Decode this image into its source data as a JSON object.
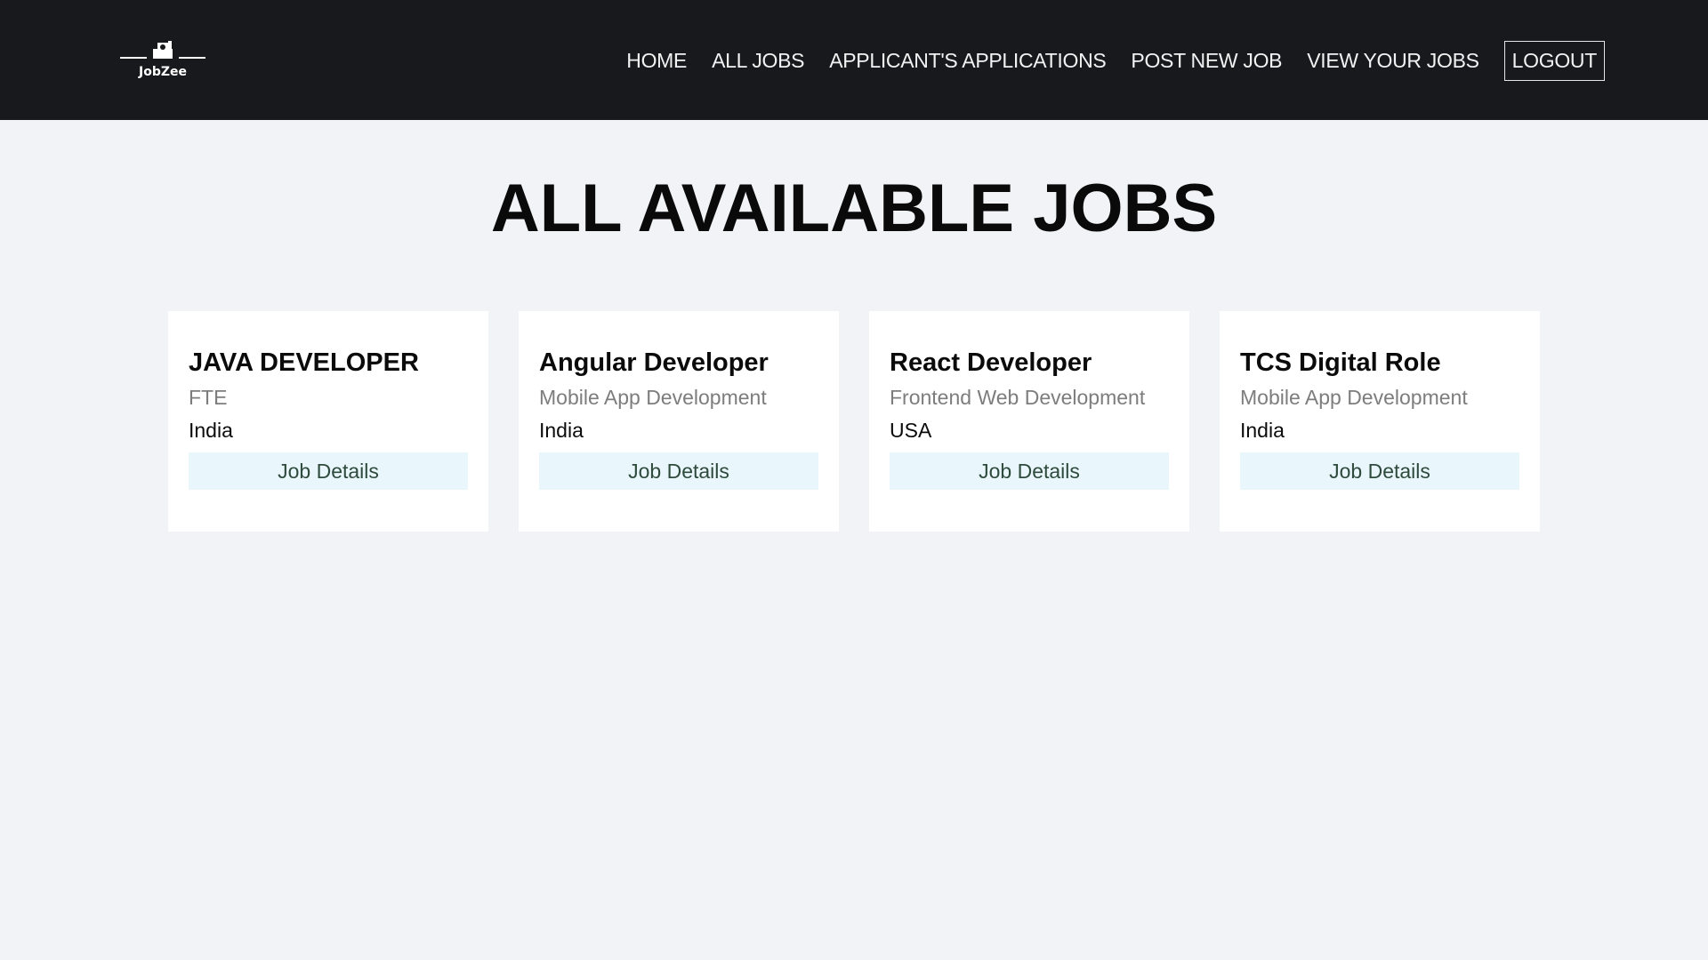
{
  "brand": {
    "logo_text": "JobZee",
    "logo_icon": "briefcase-hand-logo"
  },
  "nav": {
    "links": [
      {
        "label": "HOME"
      },
      {
        "label": "ALL JOBS"
      },
      {
        "label": "APPLICANT'S APPLICATIONS"
      },
      {
        "label": "POST NEW JOB"
      },
      {
        "label": "VIEW YOUR JOBS"
      }
    ],
    "logout_label": "LOGOUT"
  },
  "page": {
    "title": "ALL AVAILABLE JOBS"
  },
  "jobs": [
    {
      "title": "JAVA DEVELOPER",
      "category": "FTE",
      "country": "India",
      "button_label": "Job Details"
    },
    {
      "title": "Angular Developer",
      "category": "Mobile App Development",
      "country": "India",
      "button_label": "Job Details"
    },
    {
      "title": "React Developer",
      "category": "Frontend Web Development",
      "country": "USA",
      "button_label": "Job Details"
    },
    {
      "title": "TCS Digital Role",
      "category": "Mobile App Development",
      "country": "India",
      "button_label": "Job Details"
    }
  ],
  "colors": {
    "navbar_bg": "#18191d",
    "page_bg": "#f1f3f6",
    "button_bg": "#e9f6fb"
  }
}
